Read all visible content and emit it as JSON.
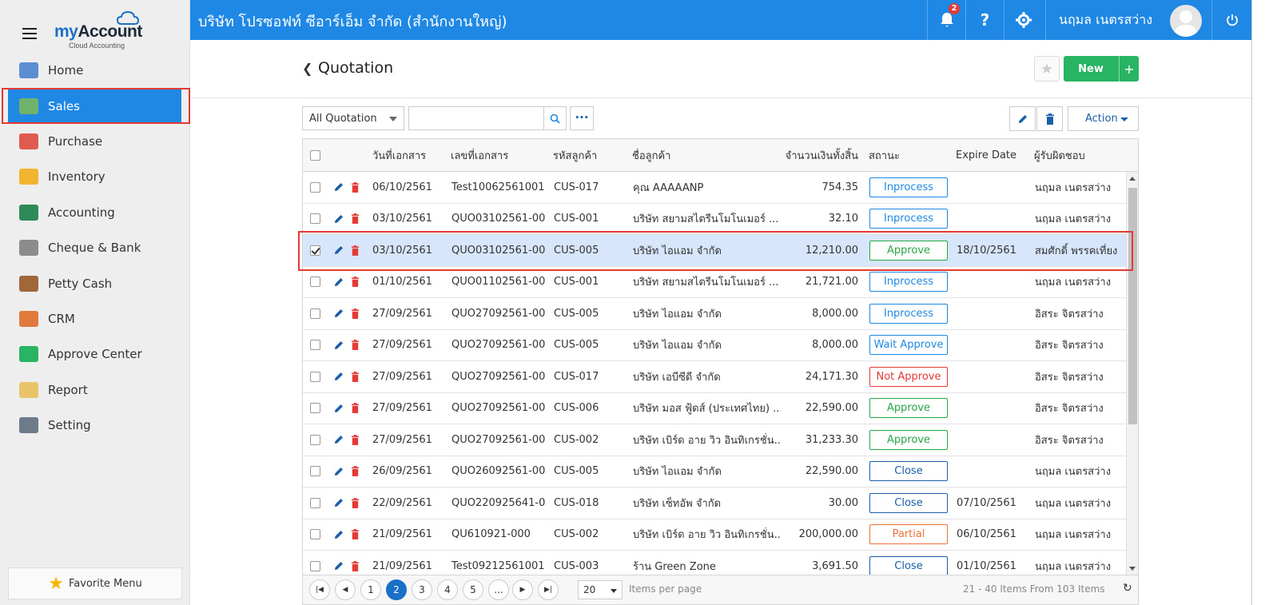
{
  "app": {
    "brand_my": "my",
    "brand_account": "Account",
    "brand_sub": "Cloud Accounting"
  },
  "sidebar": {
    "items": [
      {
        "label": "Home",
        "icon": "home-icon",
        "color": "#5b8fd1"
      },
      {
        "label": "Sales",
        "icon": "money-icon",
        "color": "#6fb36a"
      },
      {
        "label": "Purchase",
        "icon": "cart-icon",
        "color": "#e05a4f"
      },
      {
        "label": "Inventory",
        "icon": "box-icon",
        "color": "#f2b531"
      },
      {
        "label": "Accounting",
        "icon": "book-icon",
        "color": "#2e8b57"
      },
      {
        "label": "Cheque & Bank",
        "icon": "bank-icon",
        "color": "#8c8c8c"
      },
      {
        "label": "Petty Cash",
        "icon": "wallet-icon",
        "color": "#a0673a"
      },
      {
        "label": "CRM",
        "icon": "person-icon",
        "color": "#e07a3c"
      },
      {
        "label": "Approve Center",
        "icon": "check-circle-icon",
        "color": "#28b463"
      },
      {
        "label": "Report",
        "icon": "report-icon",
        "color": "#e9c46a"
      },
      {
        "label": "Setting",
        "icon": "tools-icon",
        "color": "#6c7a89"
      }
    ],
    "favorite_label": "Favorite Menu"
  },
  "topbar": {
    "company": "บริษัท โปรซอฟท์ ซีอาร์เอ็ม จำกัด (สำนักงานใหญ่)",
    "notification_count": "2",
    "help": "?",
    "username": "นฤมล เนตรสว่าง"
  },
  "page": {
    "title": "Quotation",
    "new_label": "New",
    "plus": "+",
    "filter_value": "All Quotation",
    "search_placeholder": "",
    "more": "•••",
    "action_label": "Action"
  },
  "grid": {
    "headers": {
      "date": "วันที่เอกสาร",
      "docno": "เลขที่เอกสาร",
      "custcode": "รหัสลูกค้า",
      "custname": "ชื่อลูกค้า",
      "amount": "จำนวนเงินทั้งสิ้น",
      "status": "สถานะ",
      "expire": "Expire Date",
      "owner": "ผู้รับผิดชอบ"
    },
    "rows": [
      {
        "date": "06/10/2561",
        "docno": "Test10062561001",
        "custcode": "CUS-017",
        "custname": "คุณ AAAAANP",
        "amount": "754.35",
        "status": "Inprocess",
        "status_class": "st-inprocess",
        "expire": "",
        "owner": "นฤมล เนตรสว่าง",
        "checked": false
      },
      {
        "date": "03/10/2561",
        "docno": "QUO03102561-00...",
        "custcode": "CUS-001",
        "custname": "บริษัท สยามสไตรีนโมโนเมอร์ ...",
        "amount": "32.10",
        "status": "Inprocess",
        "status_class": "st-inprocess",
        "expire": "",
        "owner": "นฤมล เนตรสว่าง",
        "checked": false
      },
      {
        "date": "03/10/2561",
        "docno": "QUO03102561-00...",
        "custcode": "CUS-005",
        "custname": "บริษัท ไอแอม จำกัด",
        "amount": "12,210.00",
        "status": "Approve",
        "status_class": "st-approve",
        "expire": "18/10/2561",
        "owner": "สมศักดิ์ พรรคเที่ยง",
        "checked": true
      },
      {
        "date": "01/10/2561",
        "docno": "QUO01102561-00...",
        "custcode": "CUS-001",
        "custname": "บริษัท สยามสไตรีนโมโนเมอร์ ...",
        "amount": "21,721.00",
        "status": "Inprocess",
        "status_class": "st-inprocess",
        "expire": "",
        "owner": "นฤมล เนตรสว่าง",
        "checked": false
      },
      {
        "date": "27/09/2561",
        "docno": "QUO27092561-00...",
        "custcode": "CUS-005",
        "custname": "บริษัท ไอแอม จำกัด",
        "amount": "8,000.00",
        "status": "Inprocess",
        "status_class": "st-inprocess",
        "expire": "",
        "owner": "อิสระ จิตรสว่าง",
        "checked": false
      },
      {
        "date": "27/09/2561",
        "docno": "QUO27092561-00...",
        "custcode": "CUS-005",
        "custname": "บริษัท ไอแอม จำกัด",
        "amount": "8,000.00",
        "status": "Wait Approve",
        "status_class": "st-wait",
        "expire": "",
        "owner": "อิสระ จิตรสว่าง",
        "checked": false
      },
      {
        "date": "27/09/2561",
        "docno": "QUO27092561-00...",
        "custcode": "CUS-017",
        "custname": "บริษัท เอบีซีดี จำกัด",
        "amount": "24,171.30",
        "status": "Not Approve",
        "status_class": "st-notapprove",
        "expire": "",
        "owner": "อิสระ จิตรสว่าง",
        "checked": false
      },
      {
        "date": "27/09/2561",
        "docno": "QUO27092561-00...",
        "custcode": "CUS-006",
        "custname": "บริษัท มอส ฟู้ดส์ (ประเทศไทย) ...",
        "amount": "22,590.00",
        "status": "Approve",
        "status_class": "st-approve",
        "expire": "",
        "owner": "อิสระ จิตรสว่าง",
        "checked": false
      },
      {
        "date": "27/09/2561",
        "docno": "QUO27092561-00...",
        "custcode": "CUS-002",
        "custname": "บริษัท เบิร์ด อาย วิว อินทิเกรชั่น...",
        "amount": "31,233.30",
        "status": "Approve",
        "status_class": "st-approve",
        "expire": "",
        "owner": "อิสระ จิตรสว่าง",
        "checked": false
      },
      {
        "date": "26/09/2561",
        "docno": "QUO26092561-00...",
        "custcode": "CUS-005",
        "custname": "บริษัท ไอแอม จำกัด",
        "amount": "22,590.00",
        "status": "Close",
        "status_class": "st-close",
        "expire": "",
        "owner": "นฤมล เนตรสว่าง",
        "checked": false
      },
      {
        "date": "22/09/2561",
        "docno": "QUO220925641-0...",
        "custcode": "CUS-018",
        "custname": "บริษัท เซ็ทอัพ จำกัด",
        "amount": "30.00",
        "status": "Close",
        "status_class": "st-close",
        "expire": "07/10/2561",
        "owner": "นฤมล เนตรสว่าง",
        "checked": false
      },
      {
        "date": "21/09/2561",
        "docno": "QU610921-000",
        "custcode": "CUS-002",
        "custname": "บริษัท เบิร์ด อาย วิว อินทิเกรชั่น...",
        "amount": "200,000.00",
        "status": "Partial",
        "status_class": "st-partial",
        "expire": "06/10/2561",
        "owner": "นฤมล เนตรสว่าง",
        "checked": false
      },
      {
        "date": "21/09/2561",
        "docno": "Test09212561001",
        "custcode": "CUS-003",
        "custname": "ร้าน Green Zone",
        "amount": "3,691.50",
        "status": "Close",
        "status_class": "st-close",
        "expire": "01/10/2561",
        "owner": "นฤมล เนตรสว่าง",
        "checked": false
      }
    ]
  },
  "pager": {
    "pages": [
      "1",
      "2",
      "3",
      "4",
      "5",
      "..."
    ],
    "current": "2",
    "per_page": "20",
    "per_page_label": "Items per page",
    "info": "21 - 40 Items From 103 Items"
  }
}
